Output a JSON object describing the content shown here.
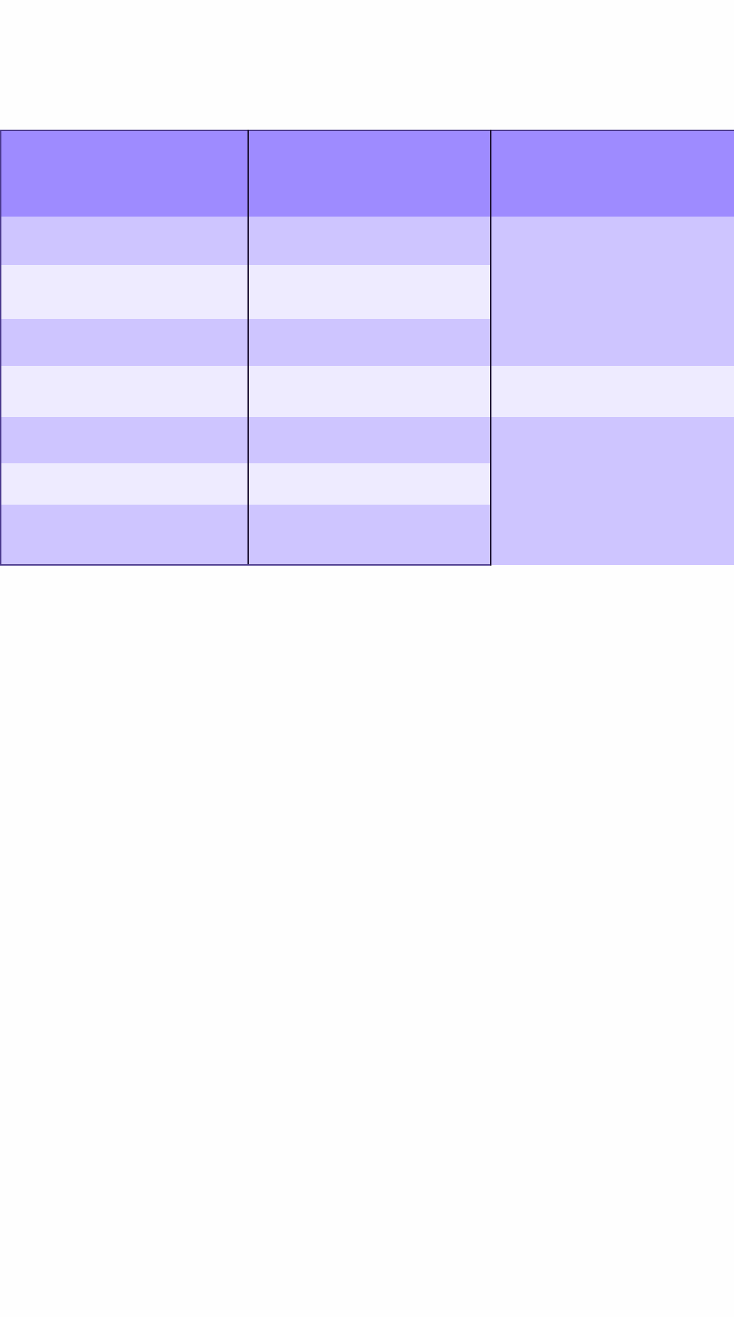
{
  "table": {
    "header": [
      "",
      "",
      ""
    ],
    "rows": [
      [
        "",
        "",
        ""
      ],
      [
        "",
        ""
      ],
      [
        "",
        ""
      ],
      [
        "",
        "",
        ""
      ],
      [
        "",
        "",
        ""
      ],
      [
        "",
        ""
      ],
      [
        "",
        ""
      ]
    ]
  },
  "colors": {
    "header_bg": "#9e8bff",
    "row_odd_bg": "#cec5ff",
    "row_even_bg": "#eeebff",
    "border": "#4b3a8e"
  }
}
